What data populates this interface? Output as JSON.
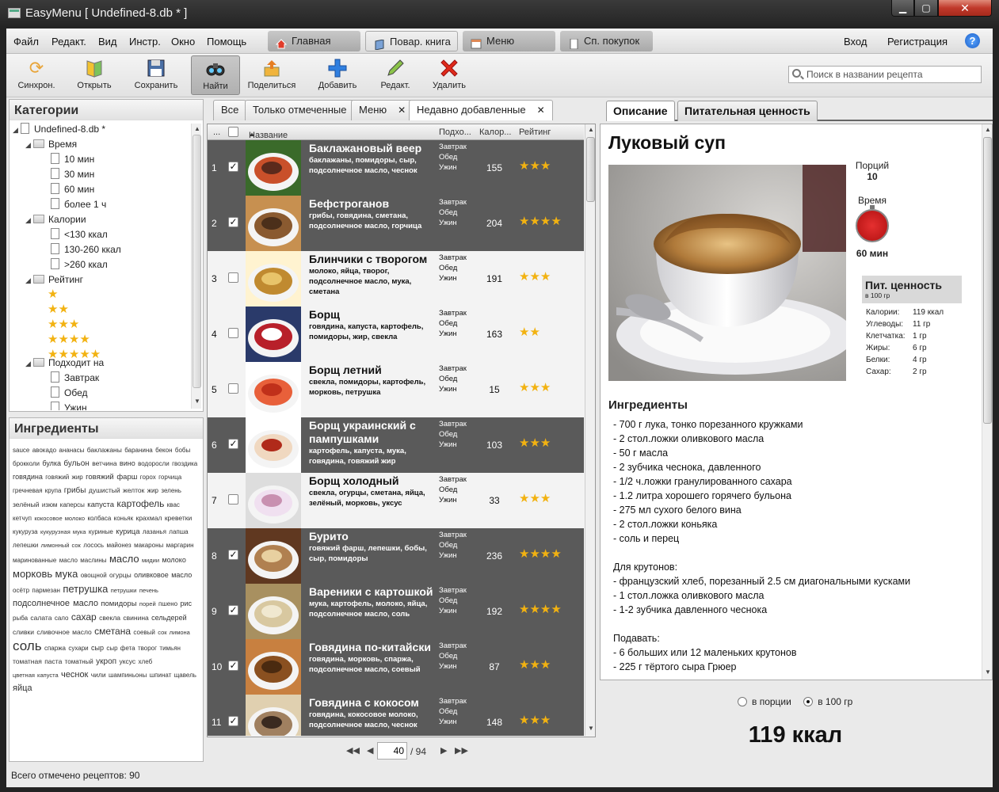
{
  "window": {
    "title": "EasyMenu [ Undefined-8.db * ]"
  },
  "menu": [
    "Файл",
    "Редакт.",
    "Вид",
    "Инстр.",
    "Окно",
    "Помощь"
  ],
  "nav": {
    "home": "Главная",
    "cookbook": "Повар. книга",
    "menu": "Меню",
    "shopping": "Сп. покупок",
    "login": "Вход",
    "register": "Регистрация",
    "help": "?"
  },
  "toolbar": {
    "sync": "Синхрон.",
    "open": "Открыть",
    "save": "Сохранить",
    "find": "Найти",
    "share": "Поделиться",
    "add": "Добавить",
    "edit": "Редакт.",
    "delete": "Удалить"
  },
  "search": {
    "placeholder": "Поиск в названии рецепта"
  },
  "categories": {
    "title": "Категории",
    "root": "Undefined-8.db *",
    "time": {
      "label": "Время",
      "items": [
        "10 мин",
        "30 мин",
        "60 мин",
        "более 1 ч"
      ]
    },
    "calories": {
      "label": "Калории",
      "items": [
        "<130 ккал",
        "130-260 ккал",
        ">260 ккал"
      ]
    },
    "rating": {
      "label": "Рейтинг",
      "levels": [
        1,
        2,
        3,
        4,
        5
      ]
    },
    "suits": {
      "label": "Подходит на",
      "items": [
        "Завтрак",
        "Обед",
        "Ужин"
      ]
    }
  },
  "ingredients_panel": {
    "title": "Ингредиенты",
    "cloud": [
      [
        "sauce",
        8
      ],
      [
        "авокадо",
        8
      ],
      [
        "ананасы",
        8
      ],
      [
        "баклажаны",
        8.5
      ],
      [
        "баранина",
        8
      ],
      [
        "бекон",
        8
      ],
      [
        "бобы",
        8
      ],
      [
        "брокколи",
        8
      ],
      [
        "булка",
        9
      ],
      [
        "бульон",
        10
      ],
      [
        "ветчина",
        8.5
      ],
      [
        "вино",
        9
      ],
      [
        "водоросли",
        8
      ],
      [
        "гвоздика",
        8
      ],
      [
        "говядина",
        9
      ],
      [
        "говяжий жир",
        8
      ],
      [
        "говяжий фарш",
        9.5
      ],
      [
        "горох",
        8
      ],
      [
        "горчица",
        8
      ],
      [
        "гречневая крупа",
        8
      ],
      [
        "грибы",
        10
      ],
      [
        "душистый",
        8.5
      ],
      [
        "желток",
        8.5
      ],
      [
        "жир",
        8
      ],
      [
        "зелень",
        8
      ],
      [
        "зелёный",
        8.5
      ],
      [
        "изюм",
        8
      ],
      [
        "каперсы",
        8
      ],
      [
        "капуста",
        9.5
      ],
      [
        "картофель",
        12
      ],
      [
        "квас",
        8
      ],
      [
        "кетчуп",
        8
      ],
      [
        "кокосовое молоко",
        7.5
      ],
      [
        "колбаса",
        8
      ],
      [
        "коньяк",
        8
      ],
      [
        "крахмал",
        8.5
      ],
      [
        "креветки",
        8.5
      ],
      [
        "кукуруза",
        8
      ],
      [
        "кукурузная мука",
        7.5
      ],
      [
        "куриные",
        8
      ],
      [
        "курица",
        9.5
      ],
      [
        "лазанья",
        8
      ],
      [
        "лапша",
        8
      ],
      [
        "лепешки",
        8
      ],
      [
        "лимонный сок",
        7.5
      ],
      [
        "лосось",
        8
      ],
      [
        "майонез",
        8
      ],
      [
        "макароны",
        8
      ],
      [
        "маргарин",
        8
      ],
      [
        "маринованные",
        8
      ],
      [
        "масло",
        8
      ],
      [
        "маслины",
        8
      ],
      [
        "масло",
        13
      ],
      [
        "мидии",
        7.5
      ],
      [
        "молоко",
        9
      ],
      [
        "морковь",
        13
      ],
      [
        "мука",
        13
      ],
      [
        "овощной",
        8
      ],
      [
        "огурцы",
        8.5
      ],
      [
        "оливковое масло",
        9
      ],
      [
        "осётр",
        8
      ],
      [
        "пармезан",
        8
      ],
      [
        "петрушка",
        13
      ],
      [
        "петрушки",
        7.5
      ],
      [
        "печень",
        7.5
      ],
      [
        "подсолнечное масло",
        11
      ],
      [
        "помидоры",
        9.5
      ],
      [
        "порей",
        7.5
      ],
      [
        "пшено",
        8
      ],
      [
        "рис",
        9
      ],
      [
        "рыба",
        8
      ],
      [
        "салата",
        8.5
      ],
      [
        "сало",
        8
      ],
      [
        "сахар",
        12
      ],
      [
        "свекла",
        8.5
      ],
      [
        "свинина",
        8.5
      ],
      [
        "сельдерей",
        9
      ],
      [
        "сливки",
        8.5
      ],
      [
        "сливочное масло",
        8.5
      ],
      [
        "сметана",
        12
      ],
      [
        "соевый",
        8
      ],
      [
        "сок лимона",
        7.5
      ],
      [
        "соль",
        17
      ],
      [
        "спаржа",
        8
      ],
      [
        "сухари",
        8
      ],
      [
        "сыр",
        9
      ],
      [
        "сыр фета",
        8
      ],
      [
        "творог",
        8
      ],
      [
        "тимьян",
        8
      ],
      [
        "томатная паста",
        8.5
      ],
      [
        "томатный",
        8
      ],
      [
        "укроп",
        10
      ],
      [
        "уксус",
        8.5
      ],
      [
        "хлеб",
        8
      ],
      [
        "цветная капуста",
        7.5
      ],
      [
        "чеснок",
        11
      ],
      [
        "чили",
        8.5
      ],
      [
        "шампиньоны",
        8
      ],
      [
        "шпинат",
        8
      ],
      [
        "щавель",
        8
      ],
      [
        "яйца",
        11
      ]
    ]
  },
  "status": "Всего отмечено рецептов: 90",
  "grid": {
    "tabs": [
      {
        "label": "Все"
      },
      {
        "label": "Только отмеченные"
      },
      {
        "label": "Меню",
        "x": "✕"
      },
      {
        "label": "Недавно добавленные",
        "x": "✕"
      }
    ],
    "headers": {
      "dots": "...",
      "name": "Название",
      "suits": "Подхо...",
      "cal": "Калор...",
      "rating": "Рейтинг"
    },
    "rows": [
      {
        "n": "1",
        "checked": true,
        "name": "Баклажановый веер",
        "ing": "баклажаны, помидоры, сыр, подсолнечное масло, чеснок",
        "cal": "155",
        "rating": 3
      },
      {
        "n": "2",
        "checked": true,
        "name": "Бефстроганов",
        "ing": "грибы, говядина, сметана, подсолнечное масло, горчица",
        "cal": "204",
        "rating": 4
      },
      {
        "n": "3",
        "checked": false,
        "name": "Блинчики с творогом",
        "ing": "молоко, яйца, творог, подсолнечное масло, мука, сметана",
        "cal": "191",
        "rating": 3
      },
      {
        "n": "4",
        "checked": false,
        "name": "Борщ",
        "ing": "говядина, капуста, картофель, помидоры, жир, свекла",
        "cal": "163",
        "rating": 2
      },
      {
        "n": "5",
        "checked": false,
        "name": "Борщ летний",
        "ing": "свекла, помидоры, картофель, морковь, петрушка",
        "cal": "15",
        "rating": 3
      },
      {
        "n": "6",
        "checked": true,
        "name": "Борщ украинский с пампушками",
        "ing": "картофель, капуста, мука, говядина, говяжий жир",
        "cal": "103",
        "rating": 3
      },
      {
        "n": "7",
        "checked": false,
        "name": "Борщ холодный",
        "ing": "свекла, огурцы, сметана, яйца, зелёный, морковь, уксус",
        "cal": "33",
        "rating": 3
      },
      {
        "n": "8",
        "checked": true,
        "name": "Бурито",
        "ing": "говяжий фарш, лепешки, бобы, сыр, помидоры",
        "cal": "236",
        "rating": 4
      },
      {
        "n": "9",
        "checked": true,
        "name": "Вареники с картошкой",
        "ing": "мука, картофель, молоко, яйца, подсолнечное масло, соль",
        "cal": "192",
        "rating": 4
      },
      {
        "n": "10",
        "checked": true,
        "name": "Говядина по-китайски",
        "ing": "говядина, морковь, спаржа, подсолнечное масло, соевый",
        "cal": "87",
        "rating": 3
      },
      {
        "n": "11",
        "checked": true,
        "name": "Говядина с кокосом",
        "ing": "говядина, кокосовое молоко, подсолнечное масло, чеснок",
        "cal": "148",
        "rating": 3
      }
    ],
    "meals": [
      "Завтрак",
      "Обед",
      "Ужин"
    ],
    "pager": {
      "page": "40",
      "total": "/ 94"
    }
  },
  "detail": {
    "tabs": [
      "Описание",
      "Питательная ценность"
    ],
    "title": "Луковый суп",
    "portions_label": "Порций",
    "portions": "10",
    "time_label": "Время",
    "time": "60 мин",
    "nut_title": "Пит. ценность",
    "nut_sub": "в 100 гр",
    "nut": [
      {
        "k": "Калории:",
        "v": "119 ккал"
      },
      {
        "k": "Углеводы:",
        "v": "11 гр"
      },
      {
        "k": "Клетчатка:",
        "v": "1 гр"
      },
      {
        "k": "Жиры:",
        "v": "6 гр"
      },
      {
        "k": "Белки:",
        "v": "4 гр"
      },
      {
        "k": "Сахар:",
        "v": "2 гр"
      }
    ],
    "ing_title": "Ингредиенты",
    "ing_text": "- 700 г лука, тонко порезанного кружками\n- 2 стол.ложки оливкового масла\n- 50 г масла\n- 2 зубчика чеснока, давленного\n- 1/2 ч.ложки гранулированного сахара\n- 1.2 литра хорошего горячего бульона\n- 275 мл сухого белого вина\n- 2 стол.ложки коньяка\n- соль и перец\n\nДля крутонов:\n- французский хлеб, порезанный 2.5 см диагональными кусками\n- 1 стол.ложка оливкового масла\n- 1-2 зубчика давленного чеснока\n\nПодавать:\n- 6 больших или 12 маленьких крутонов\n- 225 г тёртого сыра Грюер",
    "unit_portion": "в порции",
    "unit_100": "в 100 гр",
    "kcal": "119 ккал"
  },
  "colors": {
    "dark_row": "#5a5a5a",
    "light_row": "#f3f3f3",
    "star": "#f2b211",
    "timer": "#d42020"
  }
}
